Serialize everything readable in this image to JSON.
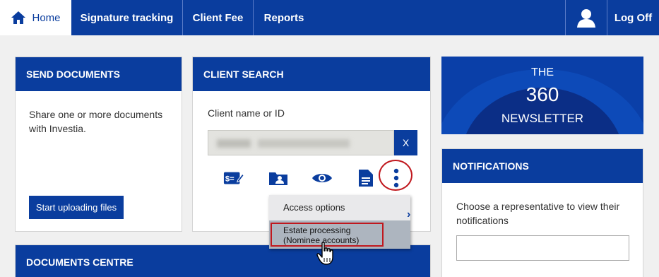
{
  "nav": {
    "home": "Home",
    "signature_tracking": "Signature tracking",
    "client_fee": "Client Fee",
    "reports": "Reports",
    "log_off": "Log Off"
  },
  "send_documents": {
    "title": "SEND DOCUMENTS",
    "description": "Share one or more documents with Investia.",
    "upload_button": "Start uploading files"
  },
  "client_search": {
    "title": "CLIENT SEARCH",
    "field_label": "Client name or ID",
    "input_value": "",
    "clear_button": "X",
    "actions": [
      "fee-icon",
      "client-folder-icon",
      "view-icon",
      "document-icon",
      "more-options-icon"
    ]
  },
  "dropdown": {
    "items": [
      "Access options",
      "Estate processing",
      "(Nominee accounts)"
    ]
  },
  "documents_centre": {
    "title": "DOCUMENTS CENTRE"
  },
  "newsletter": {
    "line1": "THE",
    "line2": "360",
    "line3": "NEWSLETTER"
  },
  "notifications": {
    "title": "NOTIFICATIONS",
    "description": "Choose a representative to view their notifications",
    "select_value": ""
  },
  "colors": {
    "brand_blue": "#0a3d9e",
    "highlight_red": "#c0181e"
  }
}
